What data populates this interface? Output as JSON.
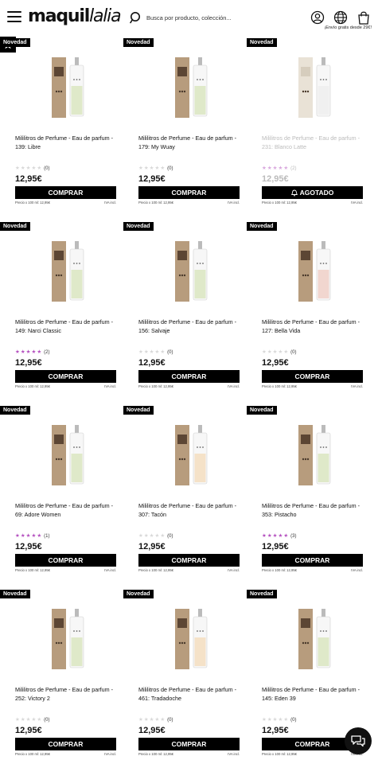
{
  "header": {
    "logo_text": "maquillalia",
    "search_placeholder": "Busca por producto, colección...",
    "shipping": "¡Envío gratis desde 29€!"
  },
  "icons": {
    "menu": "hamburger-menu-icon",
    "search": "search-icon",
    "account": "user-icon",
    "language": "globe-icon",
    "cart": "shopping-bag-icon",
    "favorites": "star-icon",
    "chat": "chat-icon"
  },
  "colors": {
    "accent": "#000000",
    "star_filled": "#b44fbf",
    "star_empty": "#d8d8d8"
  },
  "products": [
    {
      "badge": "Novedad",
      "title": "Mililitros de Perfume - Eau de parfum - 139: Libre",
      "stars": 0,
      "count": "(0)",
      "price": "12,95€",
      "button": "COMPRAR",
      "unit_price": "Precio x 100 ml: 12,95€",
      "tax": "IVA incl.",
      "sold_out": false,
      "label": "green"
    },
    {
      "badge": "Novedad",
      "title": "Mililitros de Perfume - Eau de parfum - 179: My Wuay",
      "stars": 0,
      "count": "(0)",
      "price": "12,95€",
      "button": "COMPRAR",
      "unit_price": "Precio x 100 ml: 12,95€",
      "tax": "IVA incl.",
      "sold_out": false,
      "label": "green"
    },
    {
      "badge": "Novedad",
      "title": "Mililitros de Perfume - Eau de parfum - 231: Blanco Latte",
      "stars": 5,
      "count": "(2)",
      "price": "12,95€",
      "button": "AGOTADO",
      "unit_price": "Precio x 100 ml: 12,95€",
      "tax": "IVA incl.",
      "sold_out": true,
      "label": "grey"
    },
    {
      "badge": "Novedad",
      "title": "Mililitros de Perfume - Eau de parfum - 149: Narci Classic",
      "stars": 5,
      "count": "(2)",
      "price": "12,95€",
      "button": "COMPRAR",
      "unit_price": "Precio x 100 ml: 12,95€",
      "tax": "IVA incl.",
      "sold_out": false,
      "label": "green"
    },
    {
      "badge": "Novedad",
      "title": "Mililitros de Perfume - Eau de parfum - 156: Salvaje",
      "stars": 0,
      "count": "(0)",
      "price": "12,95€",
      "button": "COMPRAR",
      "unit_price": "Precio x 100 ml: 12,95€",
      "tax": "IVA incl.",
      "sold_out": false,
      "label": "green"
    },
    {
      "badge": "Novedad",
      "title": "Mililitros de Perfume - Eau de parfum - 127: Bella Vida",
      "stars": 0,
      "count": "(0)",
      "price": "12,95€",
      "button": "COMPRAR",
      "unit_price": "Precio x 100 ml: 12,95€",
      "tax": "IVA incl.",
      "sold_out": false,
      "label": "pink"
    },
    {
      "badge": "Novedad",
      "title": "Mililitros de Perfume - Eau de parfum - 69: Adore Women",
      "stars": 5,
      "count": "(1)",
      "price": "12,95€",
      "button": "COMPRAR",
      "unit_price": "Precio x 100 ml: 12,95€",
      "tax": "IVA incl.",
      "sold_out": false,
      "label": "green"
    },
    {
      "badge": "Novedad",
      "title": "Mililitros de Perfume - Eau de parfum - 307: Tacón",
      "stars": 0,
      "count": "(0)",
      "price": "12,95€",
      "button": "COMPRAR",
      "unit_price": "Precio x 100 ml: 12,95€",
      "tax": "IVA incl.",
      "sold_out": false,
      "label": "peach"
    },
    {
      "badge": "Novedad",
      "title": "Mililitros de Perfume - Eau de parfum - 353: Pistacho",
      "stars": 5,
      "count": "(3)",
      "price": "12,95€",
      "button": "COMPRAR",
      "unit_price": "Precio x 100 ml: 12,95€",
      "tax": "IVA incl.",
      "sold_out": false,
      "label": "green"
    },
    {
      "badge": "Novedad",
      "title": "Mililitros de Perfume - Eau de parfum - 252: Victory 2",
      "stars": 0,
      "count": "(0)",
      "price": "12,95€",
      "button": "COMPRAR",
      "unit_price": "Precio x 100 ml: 12,95€",
      "tax": "IVA incl.",
      "sold_out": false,
      "label": "green"
    },
    {
      "badge": "Novedad",
      "title": "Mililitros de Perfume - Eau de parfum - 461: Tradadoche",
      "stars": 0,
      "count": "(0)",
      "price": "12,95€",
      "button": "COMPRAR",
      "unit_price": "Precio x 100 ml: 12,95€",
      "tax": "IVA incl.",
      "sold_out": false,
      "label": "peach"
    },
    {
      "badge": "Novedad",
      "title": "Mililitros de Perfume - Eau de parfum - 145: Eden 39",
      "stars": 0,
      "count": "(0)",
      "price": "12,95€",
      "button": "COMPRAR",
      "unit_price": "Precio x 100 ml: 12,95€",
      "tax": "IVA incl.",
      "sold_out": false,
      "label": "green"
    }
  ]
}
